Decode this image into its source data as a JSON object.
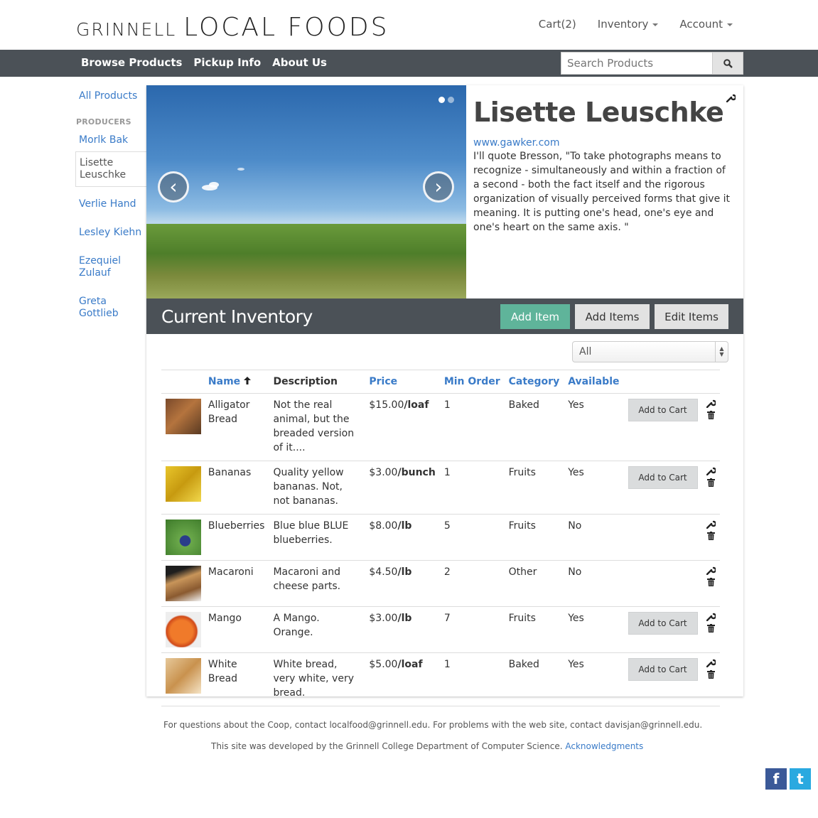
{
  "brand": {
    "part1": "GRINNELL",
    "part2": "LOCAL FOODS"
  },
  "topnav": {
    "cart": "Cart(2)",
    "inventory": "Inventory",
    "account": "Account"
  },
  "navbar": {
    "browse": "Browse Products",
    "pickup": "Pickup Info",
    "about": "About Us",
    "search_placeholder": "Search Products"
  },
  "sidebar": {
    "all": "All Products",
    "header": "PRODUCERS",
    "producers": [
      "Morlk Bak",
      "Lisette Leuschke",
      "Verlie Hand",
      "Lesley Kiehn",
      "Ezequiel Zulauf",
      "Greta Gottlieb"
    ]
  },
  "producer": {
    "name": "Lisette Leuschke",
    "url": "www.gawker.com",
    "bio": "I'll quote Bresson, \"To take photographs means to recognize - simultaneously and within a fraction of a second - both the fact itself and the rigorous organization of visually perceived forms that give it meaning. It is putting one's head, one's eye and one's heart on the same axis. \""
  },
  "carousel": {
    "prev": "‹",
    "next": "›"
  },
  "inventory": {
    "title": "Current Inventory",
    "add_item": "Add Item",
    "add_items": "Add Items",
    "edit_items": "Edit Items",
    "filter": "All",
    "columns": {
      "name": "Name",
      "description": "Description",
      "price": "Price",
      "min_order": "Min Order",
      "category": "Category",
      "available": "Available"
    },
    "add_to_cart": "Add to Cart",
    "rows": [
      {
        "name": "Alligator Bread",
        "description": "Not the real animal, but the breaded version of it....",
        "price": "$15.00",
        "unit": "/loaf",
        "min": "1",
        "category": "Baked",
        "available": "Yes",
        "cart": true
      },
      {
        "name": "Bananas",
        "description": "Quality yellow bananas. Not, not bananas.",
        "price": "$3.00",
        "unit": "/bunch",
        "min": "1",
        "category": "Fruits",
        "available": "Yes",
        "cart": true
      },
      {
        "name": "Blueberries",
        "description": "Blue blue BLUE blueberries.",
        "price": "$8.00",
        "unit": "/lb",
        "min": "5",
        "category": "Fruits",
        "available": "No",
        "cart": false
      },
      {
        "name": "Macaroni",
        "description": "Macaroni and cheese parts.",
        "price": "$4.50",
        "unit": "/lb",
        "min": "2",
        "category": "Other",
        "available": "No",
        "cart": false
      },
      {
        "name": "Mango",
        "description": "A Mango. Orange.",
        "price": "$3.00",
        "unit": "/lb",
        "min": "7",
        "category": "Fruits",
        "available": "Yes",
        "cart": true
      },
      {
        "name": "White Bread",
        "description": "White bread, very white, very bread.",
        "price": "$5.00",
        "unit": "/loaf",
        "min": "1",
        "category": "Baked",
        "available": "Yes",
        "cart": true
      }
    ]
  },
  "footer": {
    "line1": "For questions about the Coop, contact localfood@grinnell.edu. For problems with the web site, contact davisjan@grinnell.edu.",
    "line2": "This site was developed by the Grinnell College Department of Computer Science.",
    "ack": "Acknowledgments"
  },
  "social": {
    "facebook": "f",
    "twitter": "t"
  },
  "colors": {
    "navbar": "#4b5157",
    "link": "#3a7bc8",
    "add_item": "#5fb49a"
  }
}
